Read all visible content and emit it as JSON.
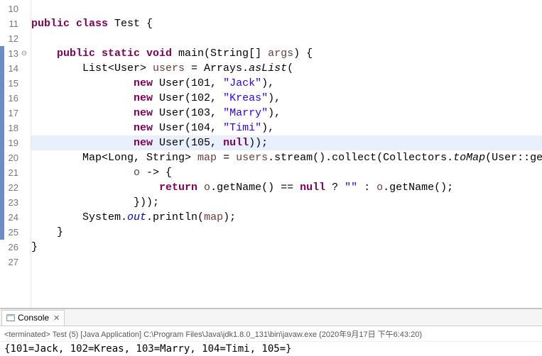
{
  "editor": {
    "lines": [
      {
        "num": "10",
        "marked": false,
        "fold": "",
        "hl": false,
        "tokens": []
      },
      {
        "num": "11",
        "marked": false,
        "fold": "",
        "hl": false,
        "tokens": [
          {
            "t": "public class ",
            "c": "kw"
          },
          {
            "t": "Test {",
            "c": "typ"
          }
        ]
      },
      {
        "num": "12",
        "marked": false,
        "fold": "",
        "hl": false,
        "tokens": []
      },
      {
        "num": "13",
        "marked": true,
        "fold": "⊖",
        "hl": false,
        "tokens": [
          {
            "t": "    ",
            "c": ""
          },
          {
            "t": "public static void ",
            "c": "kw"
          },
          {
            "t": "main(String[] ",
            "c": "typ"
          },
          {
            "t": "args",
            "c": "var"
          },
          {
            "t": ") {",
            "c": "typ"
          }
        ]
      },
      {
        "num": "14",
        "marked": true,
        "fold": "",
        "hl": false,
        "tokens": [
          {
            "t": "        List<User> ",
            "c": "typ"
          },
          {
            "t": "users",
            "c": "var"
          },
          {
            "t": " = Arrays.",
            "c": "typ"
          },
          {
            "t": "asList",
            "c": "mtd-i"
          },
          {
            "t": "(",
            "c": "typ"
          }
        ]
      },
      {
        "num": "15",
        "marked": true,
        "fold": "",
        "hl": false,
        "tokens": [
          {
            "t": "                ",
            "c": ""
          },
          {
            "t": "new ",
            "c": "kw"
          },
          {
            "t": "User(101, ",
            "c": "typ"
          },
          {
            "t": "\"Jack\"",
            "c": "str"
          },
          {
            "t": "),",
            "c": "typ"
          }
        ]
      },
      {
        "num": "16",
        "marked": true,
        "fold": "",
        "hl": false,
        "tokens": [
          {
            "t": "                ",
            "c": ""
          },
          {
            "t": "new ",
            "c": "kw"
          },
          {
            "t": "User(102, ",
            "c": "typ"
          },
          {
            "t": "\"Kreas\"",
            "c": "str"
          },
          {
            "t": "),",
            "c": "typ"
          }
        ]
      },
      {
        "num": "17",
        "marked": true,
        "fold": "",
        "hl": false,
        "tokens": [
          {
            "t": "                ",
            "c": ""
          },
          {
            "t": "new ",
            "c": "kw"
          },
          {
            "t": "User(103, ",
            "c": "typ"
          },
          {
            "t": "\"Marry\"",
            "c": "str"
          },
          {
            "t": "),",
            "c": "typ"
          }
        ]
      },
      {
        "num": "18",
        "marked": true,
        "fold": "",
        "hl": false,
        "tokens": [
          {
            "t": "                ",
            "c": ""
          },
          {
            "t": "new ",
            "c": "kw"
          },
          {
            "t": "User(104, ",
            "c": "typ"
          },
          {
            "t": "\"Timi\"",
            "c": "str"
          },
          {
            "t": "),",
            "c": "typ"
          }
        ]
      },
      {
        "num": "19",
        "marked": true,
        "fold": "",
        "hl": true,
        "tokens": [
          {
            "t": "                ",
            "c": ""
          },
          {
            "t": "new ",
            "c": "kw"
          },
          {
            "t": "User(105, ",
            "c": "typ"
          },
          {
            "t": "null",
            "c": "kw"
          },
          {
            "t": "));",
            "c": "typ"
          }
        ]
      },
      {
        "num": "20",
        "marked": true,
        "fold": "",
        "hl": false,
        "tokens": [
          {
            "t": "        Map<Long, String> ",
            "c": "typ"
          },
          {
            "t": "map",
            "c": "var"
          },
          {
            "t": " = ",
            "c": "typ"
          },
          {
            "t": "users",
            "c": "var"
          },
          {
            "t": ".stream().collect(Collectors.",
            "c": "typ"
          },
          {
            "t": "toMap",
            "c": "mtd-i"
          },
          {
            "t": "(User::getId,",
            "c": "typ"
          }
        ]
      },
      {
        "num": "21",
        "marked": true,
        "fold": "",
        "hl": false,
        "tokens": [
          {
            "t": "                ",
            "c": ""
          },
          {
            "t": "o",
            "c": "var"
          },
          {
            "t": " -> {",
            "c": "typ"
          }
        ]
      },
      {
        "num": "22",
        "marked": true,
        "fold": "",
        "hl": false,
        "tokens": [
          {
            "t": "                    ",
            "c": ""
          },
          {
            "t": "return ",
            "c": "kw"
          },
          {
            "t": "o",
            "c": "var"
          },
          {
            "t": ".getName() == ",
            "c": "typ"
          },
          {
            "t": "null ",
            "c": "kw"
          },
          {
            "t": "? ",
            "c": "typ"
          },
          {
            "t": "\"\"",
            "c": "str"
          },
          {
            "t": " : ",
            "c": "typ"
          },
          {
            "t": "o",
            "c": "var"
          },
          {
            "t": ".getName();",
            "c": "typ"
          }
        ]
      },
      {
        "num": "23",
        "marked": true,
        "fold": "",
        "hl": false,
        "tokens": [
          {
            "t": "                }));",
            "c": "typ"
          }
        ]
      },
      {
        "num": "24",
        "marked": true,
        "fold": "",
        "hl": false,
        "tokens": [
          {
            "t": "        System.",
            "c": "typ"
          },
          {
            "t": "out",
            "c": "fld-i"
          },
          {
            "t": ".println(",
            "c": "typ"
          },
          {
            "t": "map",
            "c": "var"
          },
          {
            "t": ");",
            "c": "typ"
          }
        ]
      },
      {
        "num": "25",
        "marked": true,
        "fold": "",
        "hl": false,
        "tokens": [
          {
            "t": "    }",
            "c": "typ"
          }
        ]
      },
      {
        "num": "26",
        "marked": false,
        "fold": "",
        "hl": false,
        "tokens": [
          {
            "t": "}",
            "c": "typ"
          }
        ]
      },
      {
        "num": "27",
        "marked": false,
        "fold": "",
        "hl": false,
        "tokens": []
      }
    ]
  },
  "console": {
    "tab_label": "Console",
    "close_x": "✕",
    "header": "<terminated> Test (5) [Java Application] C:\\Program Files\\Java\\jdk1.8.0_131\\bin\\javaw.exe (2020年9月17日 下午6:43:20)",
    "output": "{101=Jack, 102=Kreas, 103=Marry, 104=Timi, 105=}"
  }
}
